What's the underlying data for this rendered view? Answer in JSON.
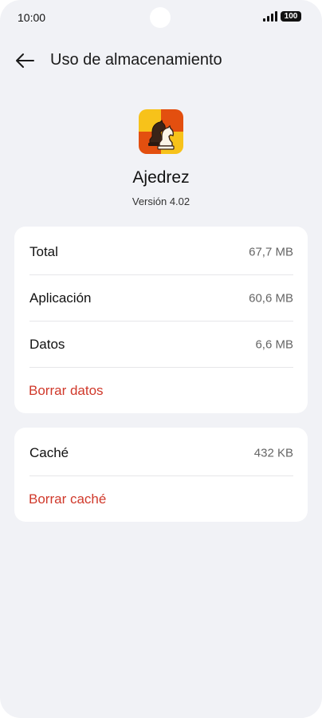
{
  "status_bar": {
    "time": "10:00",
    "battery": "100"
  },
  "header": {
    "title": "Uso de almacenamiento",
    "back_icon": "arrow-left-icon"
  },
  "app": {
    "name": "Ajedrez",
    "version": "Versión 4.02",
    "icon": "chess-knight-icon",
    "icon_colors": [
      "#f7c21a",
      "#e34f0f"
    ]
  },
  "storage": {
    "rows": [
      {
        "label": "Total",
        "value": "67,7 MB"
      },
      {
        "label": "Aplicación",
        "value": "60,6 MB"
      },
      {
        "label": "Datos",
        "value": "6,6 MB"
      }
    ],
    "clear_data_label": "Borrar datos"
  },
  "cache": {
    "label": "Caché",
    "value": "432 KB",
    "clear_cache_label": "Borrar caché"
  },
  "colors": {
    "background": "#f1f2f6",
    "card": "#ffffff",
    "action_red": "#d0392b"
  }
}
